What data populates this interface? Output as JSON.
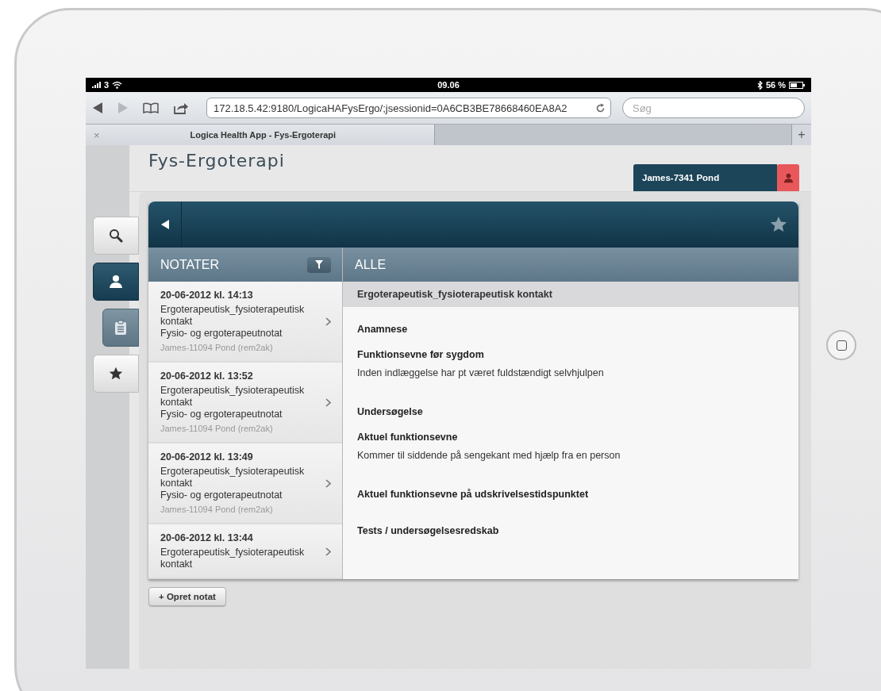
{
  "status_bar": {
    "carrier": "3",
    "time": "09.06",
    "battery": "56 %"
  },
  "browser": {
    "url": "172.18.5.42:9180/LogicaHAFysErgo/;jsessionid=0A6CB3BE78668460EA8A2",
    "search": {
      "placeholder": "Søg"
    },
    "close_label": "×",
    "new_tab_label": "+",
    "tabs": [
      {
        "title": "Logica Health App - Fys-Ergoterapi",
        "selected": true
      }
    ]
  },
  "app": {
    "title": "Fys-Ergoterapi",
    "patient": "James-7341 Pond",
    "side_tabs": [
      {
        "kind": "search",
        "selected": false
      },
      {
        "kind": "person",
        "selected": true
      },
      {
        "kind": "clipboard",
        "selected": false
      },
      {
        "kind": "star",
        "selected": false
      }
    ],
    "list_header": "NOTATER",
    "notes": [
      {
        "date": "20-06-2012 kl. 14:13",
        "subject": "Ergoterapeutisk_fysioterapeutisk kontakt",
        "type": "Fysio- og ergoterapeutnotat",
        "author": "James-11094 Pond (rem2ak)"
      },
      {
        "date": "20-06-2012 kl. 13:52",
        "subject": "Ergoterapeutisk_fysioterapeutisk kontakt",
        "type": "Fysio- og ergoterapeutnotat",
        "author": "James-11094 Pond (rem2ak)"
      },
      {
        "date": "20-06-2012 kl. 13:49",
        "subject": "Ergoterapeutisk_fysioterapeutisk kontakt",
        "type": "Fysio- og ergoterapeutnotat",
        "author": "James-11094 Pond (rem2ak)"
      },
      {
        "date": "20-06-2012 kl. 13:44",
        "subject": "Ergoterapeutisk_fysioterapeutisk kontakt"
      }
    ],
    "content_header": "ALLE",
    "document_title": "Ergoterapeutisk_fysioterapeutisk kontakt",
    "document": [
      {
        "kind": "heading",
        "text": "Anamnese"
      },
      {
        "kind": "heading",
        "text": "Funktionsevne før sygdom"
      },
      {
        "kind": "text",
        "text": "Inden indlæggelse har pt været fuldstændigt selvhjulpen"
      },
      {
        "kind": "heading",
        "text": "Undersøgelse"
      },
      {
        "kind": "heading",
        "text": "Aktuel funktionsevne"
      },
      {
        "kind": "text",
        "text": "Kommer til siddende på sengekant med hjælp fra en person"
      },
      {
        "kind": "heading",
        "text": "Aktuel funktionsevne på udskrivelsestidspunktet"
      },
      {
        "kind": "gap"
      },
      {
        "kind": "heading",
        "text": "Tests / undersøgelsesredskab"
      }
    ],
    "create_button": "+ Opret notat"
  }
}
